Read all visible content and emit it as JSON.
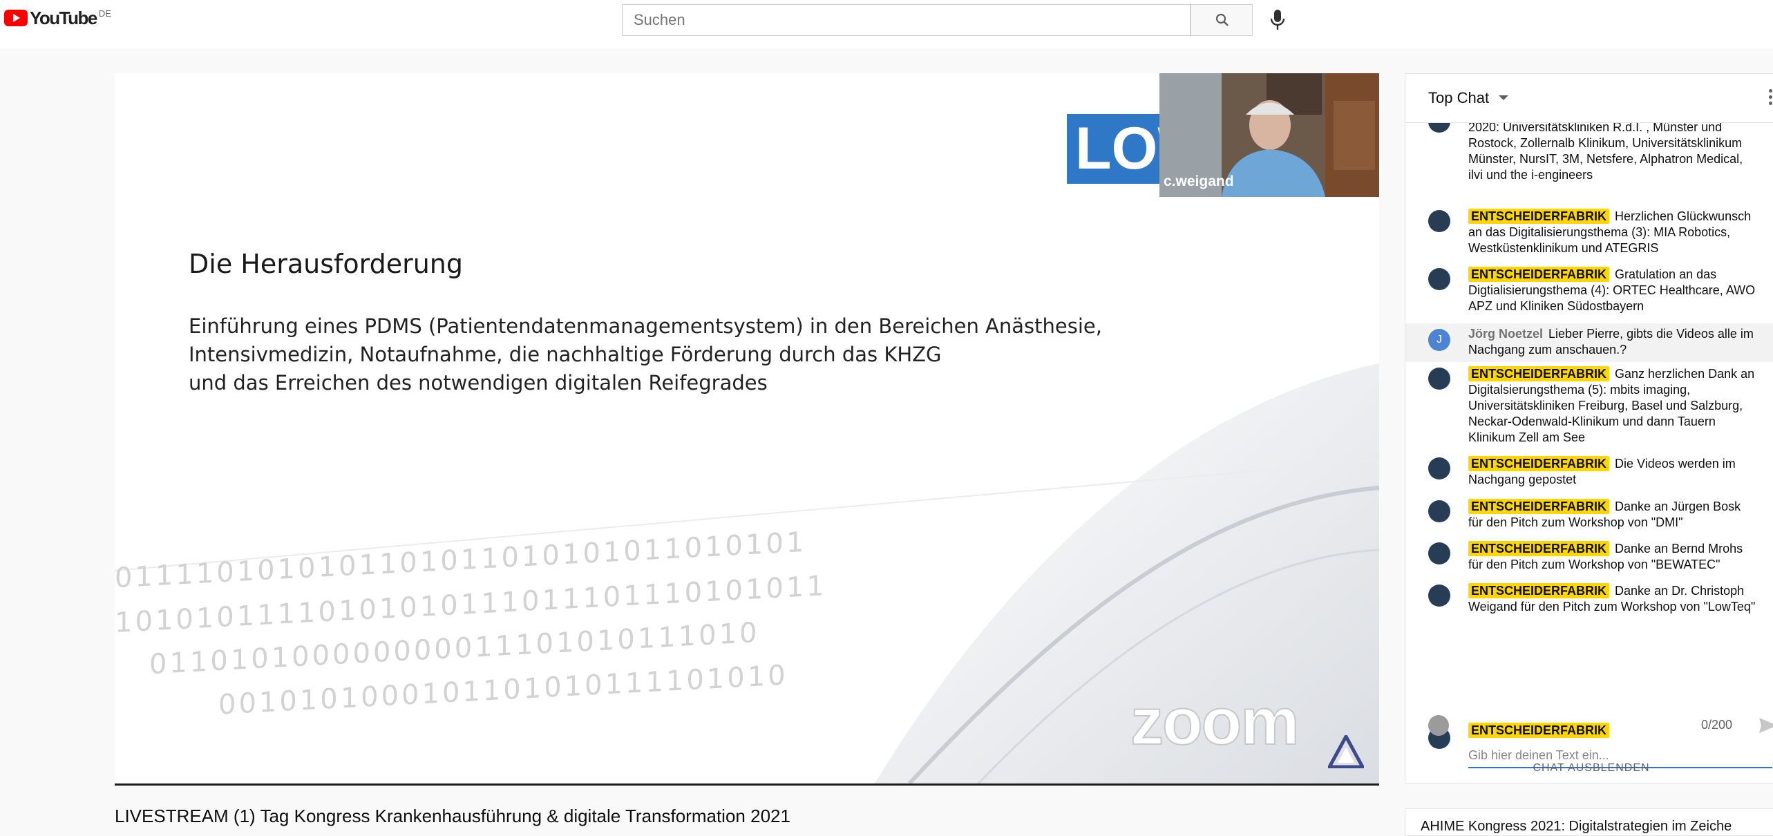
{
  "header": {
    "logo_text": "YouTube",
    "logo_country": "DE",
    "search_placeholder": "Suchen",
    "icons": [
      "search-icon",
      "microphone-icon"
    ]
  },
  "player": {
    "slide": {
      "title": "Die Herausforderung",
      "body_lines": [
        "Einführung eines PDMS (Patientendatenmanagementsystem) in den Bereichen Anästhesie,",
        "Intensivmedizin, Notaufnahme, die nachhaltige Förderung durch das KHZG",
        "und das Erreichen des notwendigen digitalen Reifegrades"
      ],
      "binary_rows": [
        "0111101010101101011010101011010101",
        "10101011110101010111011101110101011",
        "011010100000000011101010111010",
        "0010101000101101010111101010"
      ],
      "logo_text": "LOW"
    },
    "camera_name": "c.weigand",
    "watermark": "zoom"
  },
  "video_title": "LIVESTREAM (1) Tag Kongress Krankenhausführung & digitale Transformation 2021",
  "chat": {
    "header_label": "Top Chat",
    "messages": [
      {
        "badge": "",
        "author": "",
        "text": "2020: Universitätskliniken R.d.I. , Münster und Rostock, Zollernalb Klinikum, Universitätsklinikum Münster, NursIT, 3M, Netsfere, Alphatron Medical, ilvi und the i-engineers"
      },
      {
        "badge": "ENTSCHEIDERFABRIK",
        "author": "",
        "text": "Herzlichen Glückwunsch an das Digitalisierungsthema (3): MIA Robotics, Westküstenklinikum und ATEGRIS"
      },
      {
        "badge": "ENTSCHEIDERFABRIK",
        "author": "",
        "text": "Gratulation an das Digtialisierungsthema (4): ORTEC Healthcare, AWO APZ und Kliniken Südostbayern"
      },
      {
        "badge": "",
        "author": "Jörg Noetzel",
        "avatar_letter": "J",
        "text": "Lieber Pierre, gibts die Videos alle im Nachgang zum anschauen.?"
      },
      {
        "badge": "ENTSCHEIDERFABRIK",
        "author": "",
        "text": "Ganz herzlichen Dank an Digitalsierungsthema (5): mbits imaging, Universitätskliniken Freiburg, Basel und Salzburg, Neckar-Odenwald-Klinikum und dann Tauern Klinikum Zell am See"
      },
      {
        "badge": "ENTSCHEIDERFABRIK",
        "author": "",
        "text": "Die Videos werden im Nachgang gepostet"
      },
      {
        "badge": "ENTSCHEIDERFABRIK",
        "author": "",
        "text": "Danke an Jürgen Bosk für den Pitch zum Workshop von \"DMI\""
      },
      {
        "badge": "ENTSCHEIDERFABRIK",
        "author": "",
        "text": "Danke an Bernd Mrohs für den Pitch zum Workshop von \"BEWATEC\""
      },
      {
        "badge": "ENTSCHEIDERFABRIK",
        "author": "",
        "text": "Danke an Dr. Christoph Weigand für den Pitch zum Workshop von \"LowTeq\""
      }
    ],
    "input_author": "ENTSCHEIDERFABRIK",
    "input_placeholder": "Gib hier deinen Text ein...",
    "counter": "0/200",
    "hide_label": "CHAT AUSBLENDEN"
  },
  "next_video_title": "AHIME Kongress 2021: Digitalstrategien im Zeiche"
}
